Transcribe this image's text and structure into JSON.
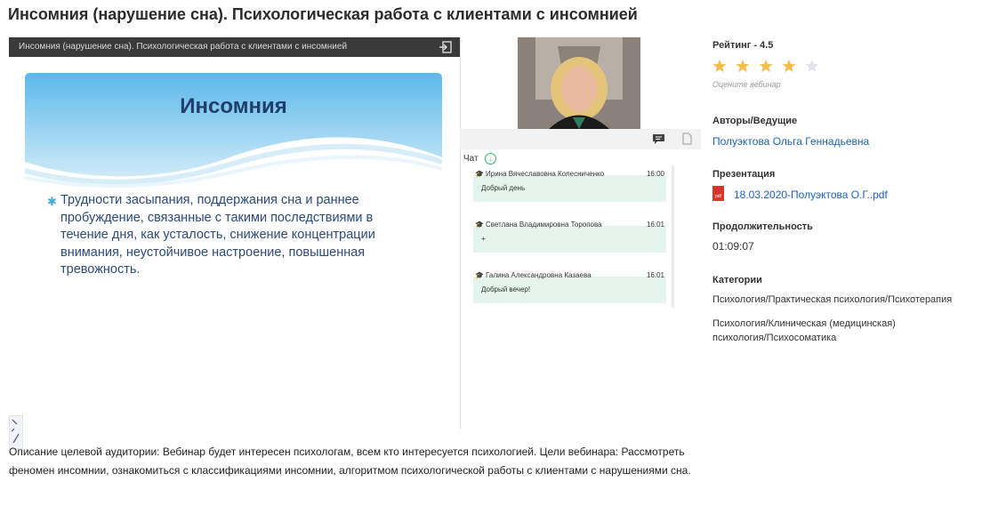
{
  "page": {
    "title": "Инсомния (нарушение сна). Психологическая работа с клиентами с инсомнией"
  },
  "player": {
    "title": "Инсомния (нарушение сна). Психологическая работа с клиентами с инсомнией",
    "exit_icon": "exit-icon",
    "slide": {
      "heading": "Инсомния",
      "bullet": "Трудности засыпания, поддержания сна и раннее пробуждение, связанные с такими последствиями в течение дня, как усталость, снижение концентрации внимания, неустойчивое настроение, повышенная тревожность."
    }
  },
  "chat": {
    "label": "Чат",
    "messages": [
      {
        "author": "Ирина Вячеславовна Колесниченко",
        "time": "16:00",
        "text": "Добрый день"
      },
      {
        "author": "Светлана Владимировна Торопова",
        "time": "16:01",
        "text": "+"
      },
      {
        "author": "Галина Александровна Казаева",
        "time": "16:01",
        "text": "Добрый вечер!"
      }
    ]
  },
  "sidebar": {
    "rating_label": "Рейтинг - 4.5",
    "rating_value": 4.5,
    "rating_max": 5,
    "rate_hint": "Оцените вебинар",
    "authors_label": "Авторы/Ведущие",
    "author": "Полуэктова Ольга Геннадьевна",
    "presentation_label": "Презентация",
    "presentation_file": "18.03.2020-Полуэктова О.Г..pdf",
    "duration_label": "Продолжительность",
    "duration": "01:09:07",
    "categories_label": "Категории",
    "categories": [
      "Психология/Практическая психология/Психотерапия",
      "Психология/Клиническая (медицинская) психология/Психосоматика"
    ]
  },
  "description": "Описание целевой аудитории: Вебинар будет интересен психологам, всем кто интересуется психологией. Цели вебинара: Рассмотреть феномен инсомнии, ознакомиться с классификациями инсомнии, алгоритмом психологической работы с клиентами с нарушениями сна.",
  "colors": {
    "accent_link": "#1a63b8",
    "star_filled": "#f2be4a",
    "star_empty": "#dfe3ea",
    "chat_bubble": "#e3f5ec",
    "slide_heading": "#1f3d6e"
  }
}
